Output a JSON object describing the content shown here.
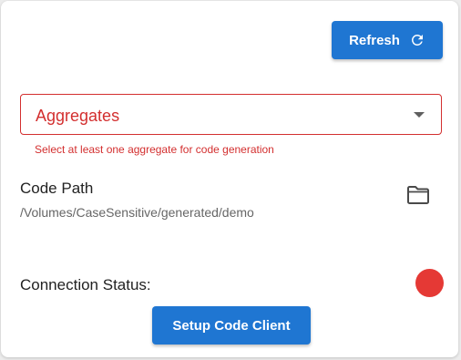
{
  "toolbar": {
    "refresh_label": "Refresh",
    "refresh_icon": "refresh-icon"
  },
  "aggregates": {
    "label": "Aggregates",
    "helper_text": "Select at least one aggregate for code generation",
    "dropdown_icon": "caret-down-icon"
  },
  "code_path": {
    "label": "Code Path",
    "value": "/Volumes/CaseSensitive/generated/demo",
    "browse_icon": "folder-icon"
  },
  "connection": {
    "label": "Connection Status:",
    "status_color": "#e53935"
  },
  "setup": {
    "label": "Setup Code Client"
  },
  "colors": {
    "primary": "#1f76d2",
    "error": "#d32f2f"
  }
}
